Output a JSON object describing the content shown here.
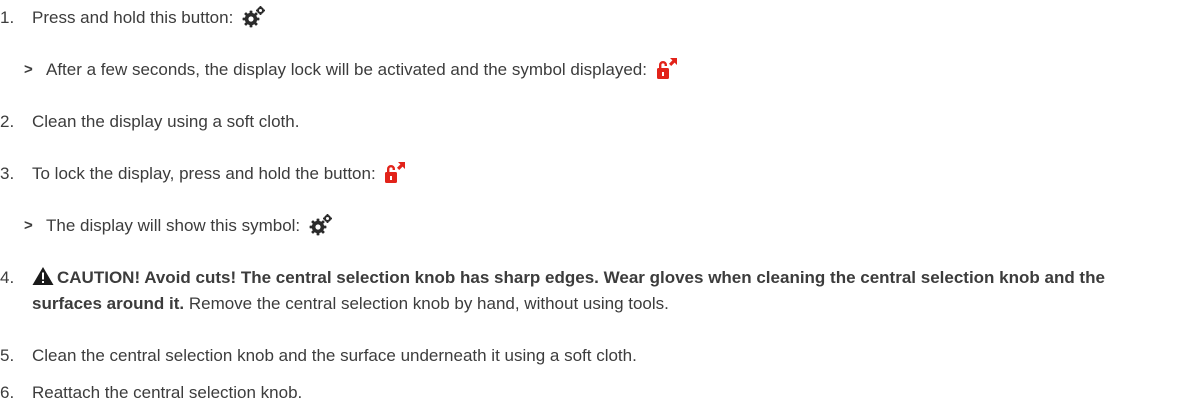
{
  "steps": [
    {
      "number": "1.",
      "text": "Press and hold this button:",
      "icon": "settings-gear-icon"
    },
    {
      "marker": ">",
      "text": "After a few seconds, the display lock will be activated and the symbol displayed:",
      "icon": "unlock-icon"
    },
    {
      "number": "2.",
      "text": "Clean the display using a soft cloth."
    },
    {
      "number": "3.",
      "text": "To lock the display, press and hold the button:",
      "icon": "unlock-icon"
    },
    {
      "marker": ">",
      "text": "The display will show this symbol:",
      "icon": "settings-gear-icon"
    },
    {
      "number": "4.",
      "warning_icon": "warning-triangle-icon",
      "warning_bold": "CAUTION! Avoid cuts! The central selection knob has sharp edges. Wear gloves when cleaning the central selection knob and the surfaces around it.",
      "text": " Remove the central selection knob by hand, without using tools."
    },
    {
      "number": "5.",
      "text": "Clean the central selection knob and the surface underneath it using a soft cloth."
    },
    {
      "number": "6.",
      "text": "Reattach the central selection knob."
    }
  ],
  "colors": {
    "text": "#3c3c3c",
    "accent_red": "#e2231a",
    "icon_dark": "#2b2b2b"
  }
}
